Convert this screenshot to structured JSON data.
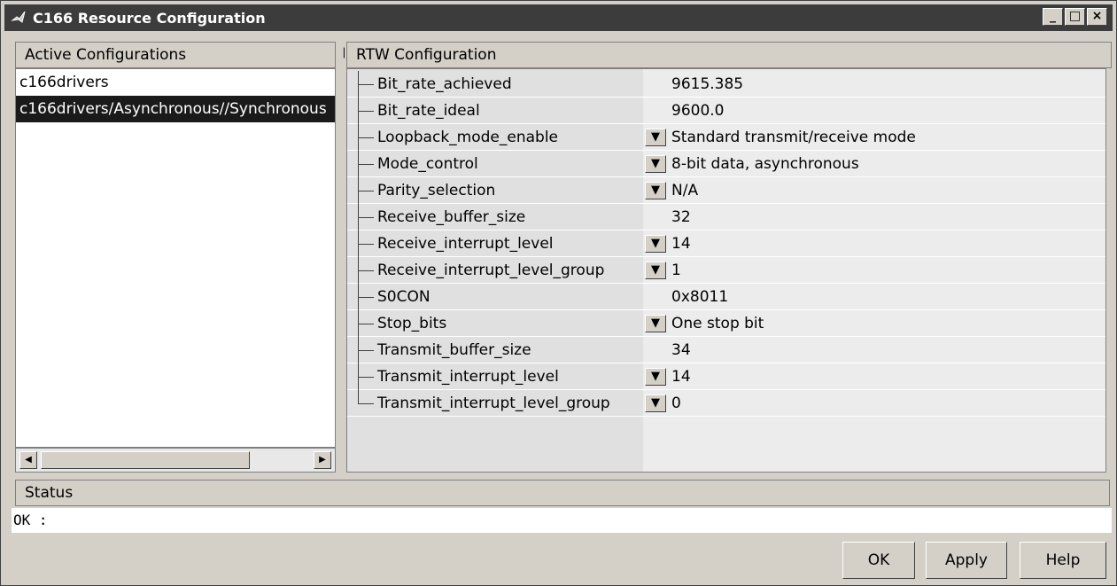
{
  "window": {
    "title": "C166 Resource Configuration",
    "controls": {
      "minimize": "_",
      "maximize": "□",
      "close": "×"
    }
  },
  "left_panel": {
    "header": "Active Configurations",
    "items": [
      {
        "label": "c166drivers",
        "selected": false
      },
      {
        "label": "c166drivers/Asynchronous//Synchronous",
        "selected": true
      }
    ]
  },
  "right_panel": {
    "header": "RTW Configuration",
    "properties": [
      {
        "name": "Bit_rate_achieved",
        "value": "9615.385",
        "dropdown": false
      },
      {
        "name": "Bit_rate_ideal",
        "value": "9600.0",
        "dropdown": false
      },
      {
        "name": "Loopback_mode_enable",
        "value": "Standard transmit/receive mode",
        "dropdown": true
      },
      {
        "name": "Mode_control",
        "value": "8-bit data, asynchronous",
        "dropdown": true
      },
      {
        "name": "Parity_selection",
        "value": "N/A",
        "dropdown": true
      },
      {
        "name": "Receive_buffer_size",
        "value": "32",
        "dropdown": false
      },
      {
        "name": "Receive_interrupt_level",
        "value": "14",
        "dropdown": true
      },
      {
        "name": "Receive_interrupt_level_group",
        "value": "1",
        "dropdown": true
      },
      {
        "name": "S0CON",
        "value": "0x8011",
        "dropdown": false
      },
      {
        "name": "Stop_bits",
        "value": "One stop bit",
        "dropdown": true
      },
      {
        "name": "Transmit_buffer_size",
        "value": "34",
        "dropdown": false
      },
      {
        "name": "Transmit_interrupt_level",
        "value": "14",
        "dropdown": true
      },
      {
        "name": "Transmit_interrupt_level_group",
        "value": "0",
        "dropdown": true
      }
    ]
  },
  "status": {
    "header": "Status",
    "text": "OK :"
  },
  "buttons": {
    "ok": "OK",
    "apply": "Apply",
    "help": "Help"
  }
}
